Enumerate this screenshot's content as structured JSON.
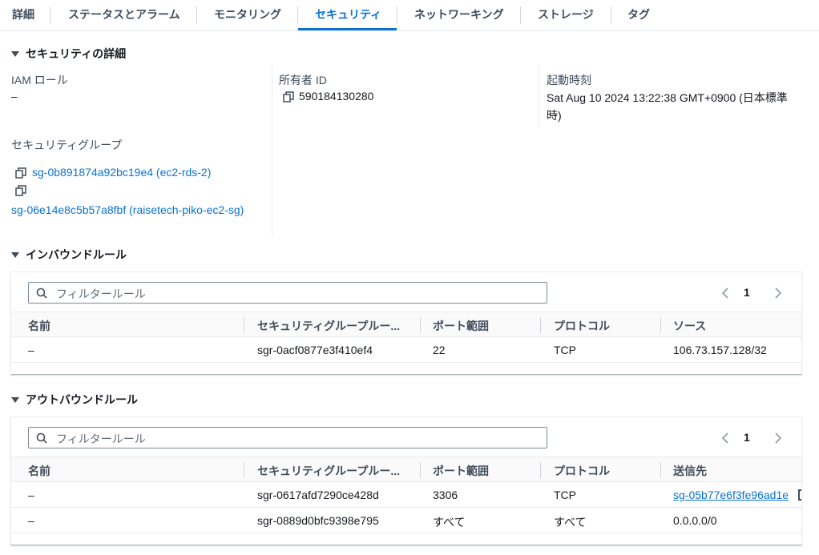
{
  "tabs": [
    "詳細",
    "ステータスとアラーム",
    "モニタリング",
    "セキュリティ",
    "ネットワーキング",
    "ストレージ",
    "タグ"
  ],
  "security_details": {
    "title": "セキュリティの詳細",
    "iam_role_label": "IAM ロール",
    "iam_role_value": "–",
    "owner_id_label": "所有者 ID",
    "owner_id_value": "590184130280",
    "launch_time_label": "起動時刻",
    "launch_time_line1": "Sat Aug 10 2024 13:22:38 GMT+0900 (日本標準",
    "launch_time_line2": "時)",
    "security_groups_label": "セキュリティグループ",
    "security_groups": [
      "sg-0b891874a92bc19e4 (ec2-rds-2)",
      "sg-06e14e8c5b57a8fbf (raisetech-piko-ec2-sg)"
    ]
  },
  "inbound": {
    "title": "インバウンドルール",
    "filter_placeholder": "フィルタールール",
    "page": "1",
    "columns": [
      "名前",
      "セキュリティグループルー...",
      "ポート範囲",
      "プロトコル",
      "ソース"
    ],
    "rows": [
      [
        "–",
        "sgr-0acf0877e3f410ef4",
        "22",
        "TCP",
        "106.73.157.128/32"
      ]
    ]
  },
  "outbound": {
    "title": "アウトバウンドルール",
    "filter_placeholder": "フィルタールール",
    "page": "1",
    "columns": [
      "名前",
      "セキュリティグループルー...",
      "ポート範囲",
      "プロトコル",
      "送信先"
    ],
    "rows": [
      [
        "–",
        "sgr-0617afd7290ce428d",
        "3306",
        "TCP",
        "sg-05b77e6f3fe96ad1e"
      ],
      [
        "–",
        "sgr-0889d0bfc9398e795",
        "すべて",
        "すべて",
        "0.0.0.0/0"
      ]
    ]
  },
  "colors": {
    "accent": "#0972d3",
    "text": "#16191f",
    "muted": "#414d5c"
  }
}
